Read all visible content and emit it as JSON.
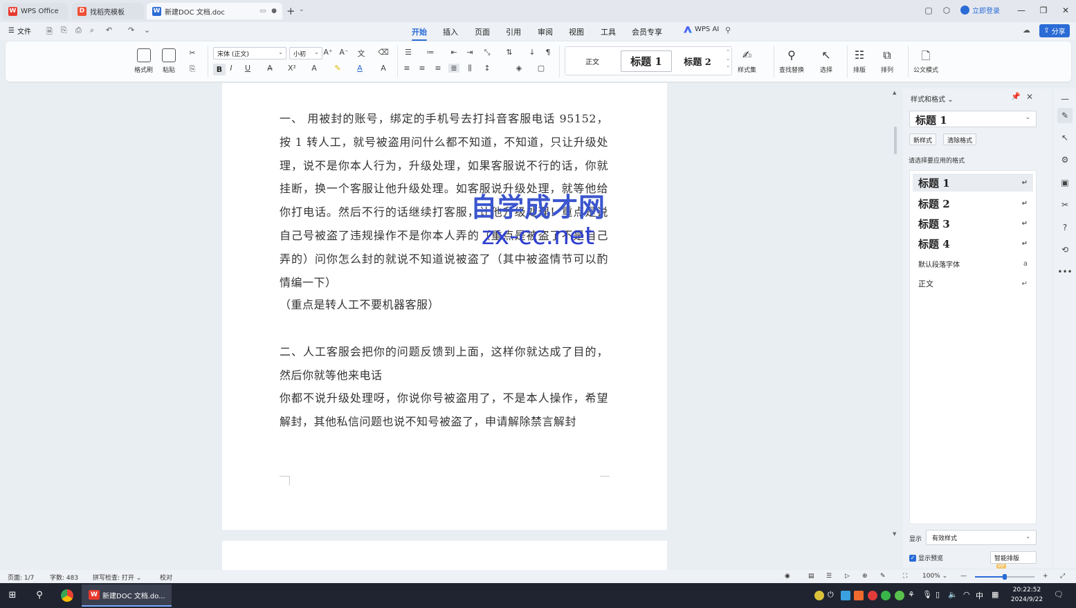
{
  "titlebar": {
    "tabs": [
      {
        "label": "WPS Office",
        "icon": "wps-logo-icon"
      },
      {
        "label": "找稻壳模板",
        "icon": "docer-icon"
      },
      {
        "label": "新建DOC 文档.doc",
        "icon": "word-doc-icon"
      }
    ],
    "login_label": "立即登录"
  },
  "menubar": {
    "file_label": "文件",
    "tabs": [
      "开始",
      "插入",
      "页面",
      "引用",
      "审阅",
      "视图",
      "工具",
      "会员专享"
    ],
    "active_tab": "开始",
    "wps_ai_label": "WPS AI",
    "share_label": "分享"
  },
  "ribbon": {
    "format_painter": "格式刷",
    "paste": "粘贴",
    "font_name": "宋体 (正文)",
    "font_size": "小初",
    "styles_gallery": [
      "正文",
      "标题 1",
      "标题 2"
    ],
    "style_set": "样式集",
    "find_replace": "查找替换",
    "select": "选择",
    "layout": "排版",
    "arrange": "排列",
    "official_mode": "公文模式"
  },
  "document": {
    "paragraphs": [
      "一、 用被封的账号，绑定的手机号去打抖音客服电话 95152，按 1 转人工，就号被盗用问什么都不知道，不知道，只让升级处理，说不是你本人行为，升级处理，如果客服说不行的话，你就挂断，换一个客服让他升级处理。如客服说升级处理，就等他给你打电话。然后不行的话继续打客服，让他升级处理！重点是说自己号被盗了违规操作不是你本人弄的（重点是被盗了不是自己弄的）问你怎么封的就说不知道说被盗了（其中被盗情节可以酌情编一下）",
      "（重点是转人工不要机器客服）",
      "二、人工客服会把你的问题反馈到上面，这样你就达成了目的，然后你就等他来电话",
      "你都不说升级处理呀，你说你号被盗用了，不是本人操作，希望解封，其他私信问题也说不知号被盗了，申请解除禁言解封"
    ],
    "watermark_line1": "自学成才网",
    "watermark_line2": "zx-cc.net"
  },
  "style_pane": {
    "title": "样式和格式",
    "current_style": "标题 1",
    "new_style": "新样式",
    "clear_format": "清除格式",
    "hint": "请选择要应用的格式",
    "styles": [
      "标题 1",
      "标题 2",
      "标题 3",
      "标题 4",
      "默认段落字体",
      "正文"
    ],
    "show_label": "显示",
    "show_value": "有效样式",
    "show_preview": "显示预览",
    "smart_layout": "智能排版",
    "vip_badge": "VIP"
  },
  "status": {
    "page": "页面: 1/7",
    "words": "字数: 483",
    "spell": "拼写检查: 打开",
    "proof": "校对",
    "zoom": "100%",
    "zoom_fraction": 0.5
  },
  "taskbar": {
    "app_label": "新建DOC 文档.do...",
    "ime": "中",
    "time": "20:22:52",
    "date": "2024/9/22"
  },
  "colors": {
    "accent": "#2a6bd6",
    "watermark": "#3b55ce"
  }
}
